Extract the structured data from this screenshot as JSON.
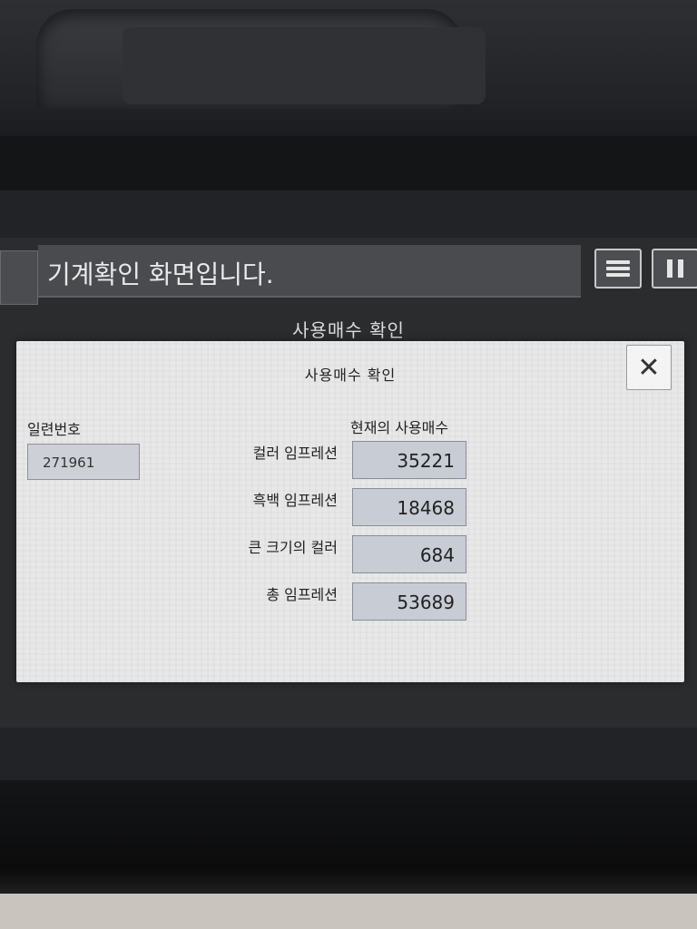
{
  "status_bar": {
    "message": "기계확인 화면입니다."
  },
  "background": {
    "title": "사용매수 확인"
  },
  "dialog": {
    "title": "사용매수 확인",
    "close_icon": "close-icon",
    "serial": {
      "label": "일련번호",
      "value": "271961"
    },
    "counter_header": "현재의 사용매수",
    "counters": [
      {
        "label": "컬러 임프레션",
        "value": "35221"
      },
      {
        "label": "흑백 임프레션",
        "value": "18468"
      },
      {
        "label": "큰 크기의 컬러",
        "value": "684"
      },
      {
        "label": "총 임프레션",
        "value": "53689"
      }
    ]
  },
  "icons": {
    "menu": "menu-icon",
    "pause": "pause-icon"
  }
}
